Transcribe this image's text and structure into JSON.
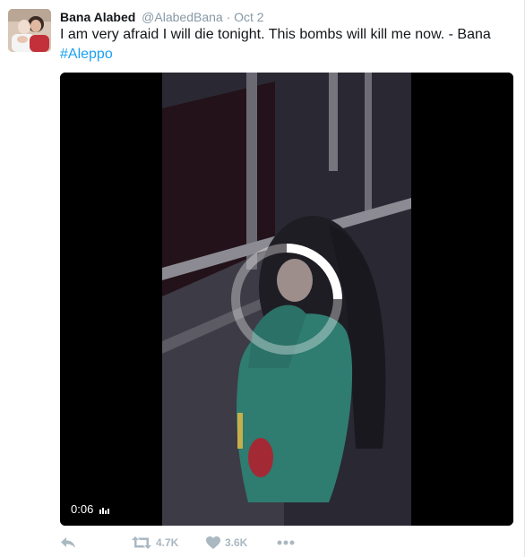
{
  "tweet": {
    "author": {
      "name": "Bana Alabed",
      "handle": "@AlabedBana",
      "separator": "·",
      "time": "Oct 2"
    },
    "text": "I am very afraid I will die tonight. This bombs will kill me now. - Bana",
    "hashtag": "#Aleppo",
    "video": {
      "duration": "0:06",
      "loading_icon": "spinner-icon"
    },
    "actions": {
      "reply_icon": "reply-icon",
      "retweet_icon": "retweet-icon",
      "retweet_count": "4.7K",
      "like_icon": "heart-icon",
      "like_count": "3.6K",
      "more_icon": "more-icon"
    }
  },
  "colors": {
    "link": "#1da1f2",
    "muted": "#8899a6",
    "action": "#aab8c2"
  }
}
